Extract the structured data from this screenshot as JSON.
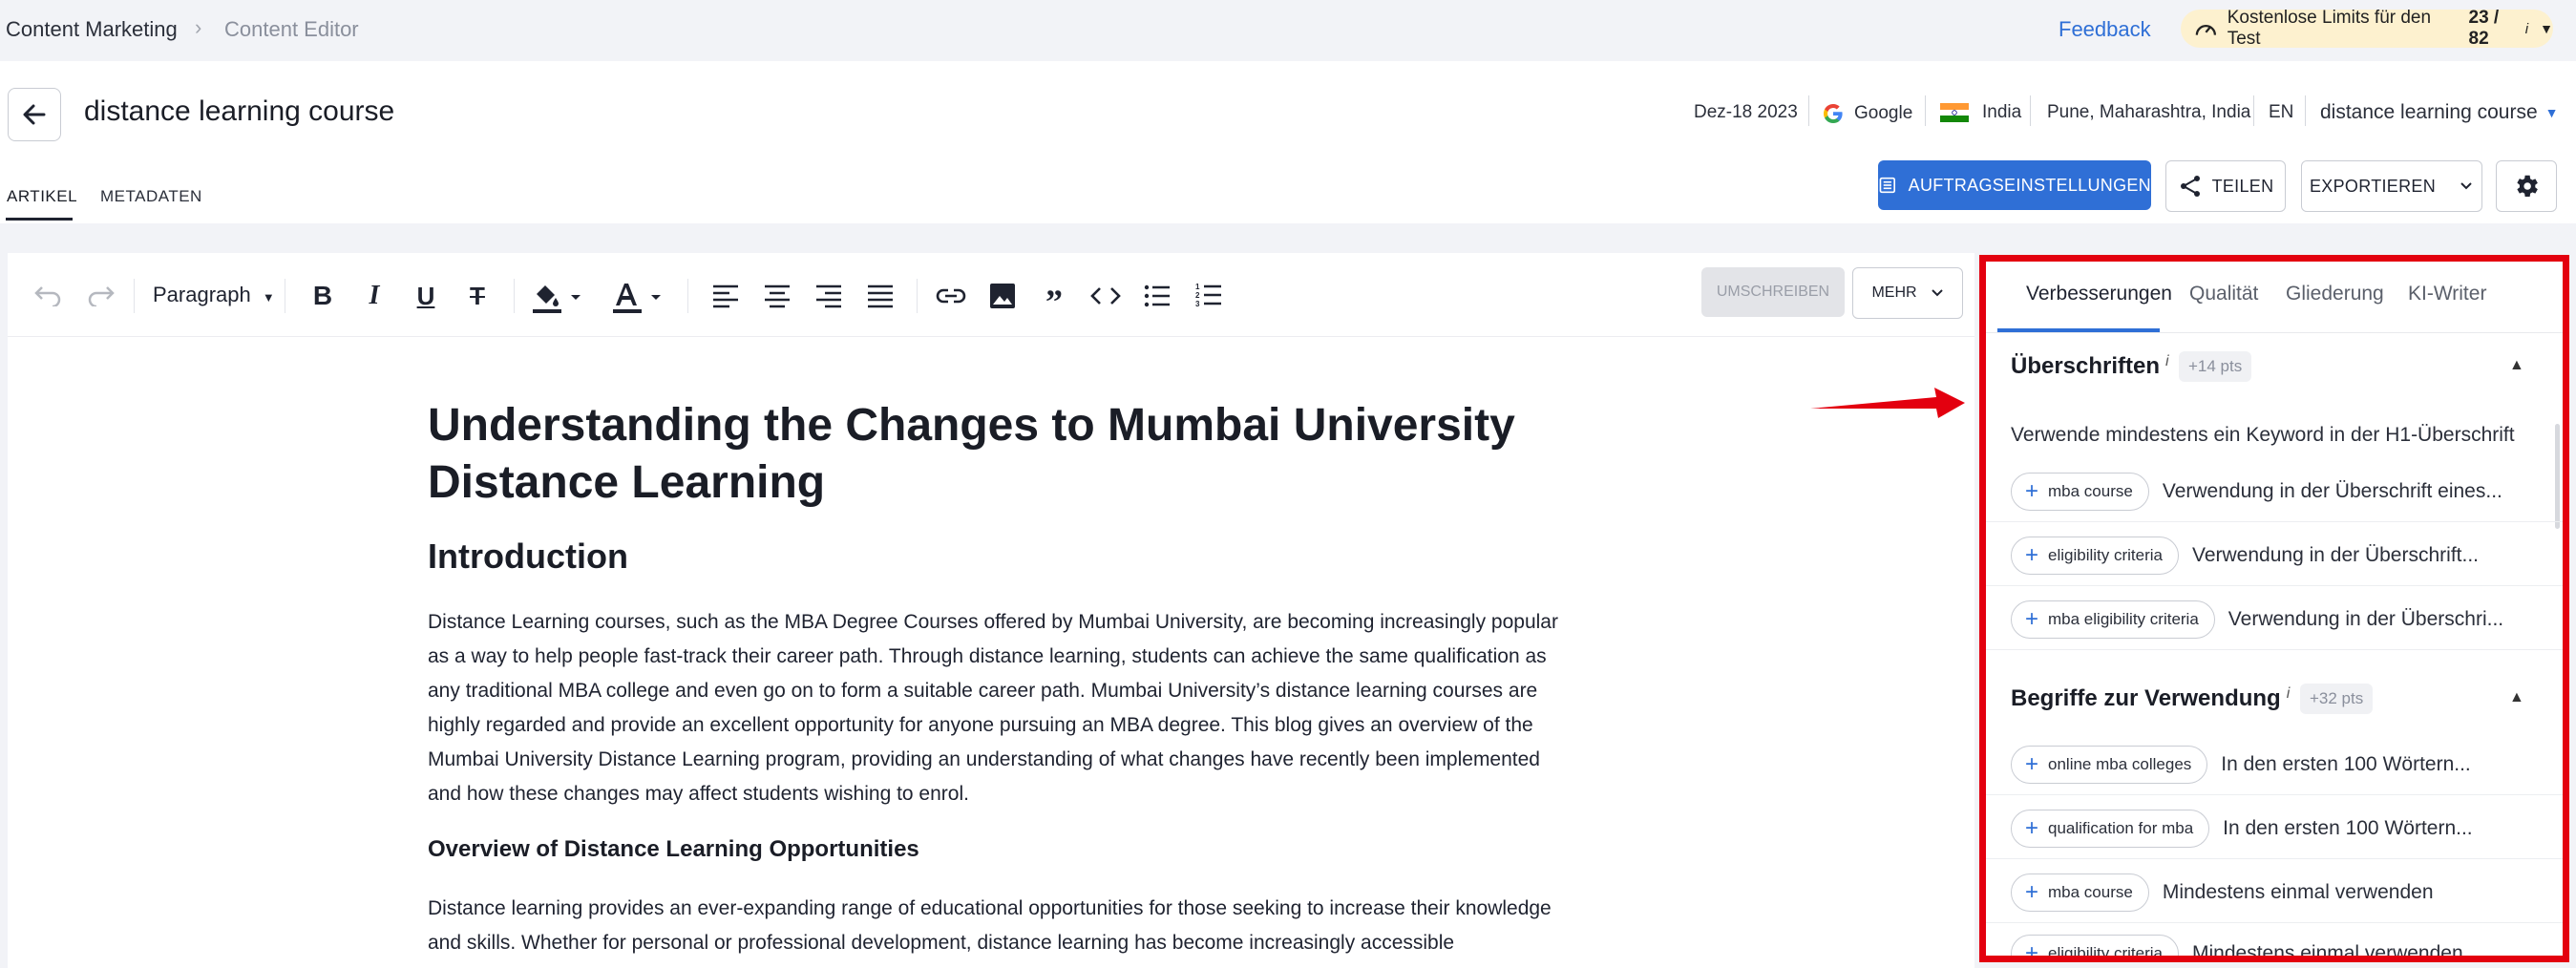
{
  "breadcrumb": {
    "item1": "Content Marketing",
    "sep": "›",
    "item2": "Content Editor"
  },
  "topbar": {
    "feedback": "Feedback",
    "limits_label": "Kostenlose Limits für den Test",
    "limits_value": "23 / 82",
    "limits_info": "i"
  },
  "header": {
    "title": "distance learning course",
    "date": "Dez-18 2023",
    "engine": "Google",
    "country": "India",
    "location": "Pune, Maharashtra, India",
    "language": "EN",
    "keyword": "distance learning course"
  },
  "tabs": {
    "article": "ARTIKEL",
    "metadata": "METADATEN"
  },
  "actions": {
    "settings": "AUFTRAGSEINSTELLUNGEN",
    "share": "TEILEN",
    "export": "EXPORTIEREN"
  },
  "toolbar": {
    "paragraph": "Paragraph",
    "rewrite": "UMSCHREIBEN",
    "more": "MEHR"
  },
  "document": {
    "h1": "Understanding the Changes to Mumbai University Distance Learning",
    "h2": "Introduction",
    "p1": "Distance Learning courses, such as the MBA Degree Courses offered by Mumbai University, are becoming increasingly popular as a way to help people fast-track their career path. Through distance learning, students can achieve the same qualification as any traditional MBA college and even go on to form a suitable career path. Mumbai University’s distance learning courses are highly regarded and provide an excellent opportunity for anyone pursuing an MBA degree. This blog gives an overview of the Mumbai University Distance Learning program, providing an understanding of what changes have recently been implemented and how these changes may affect students wishing to enrol.",
    "h3": "Overview of Distance Learning Opportunities",
    "p2": "Distance learning provides an ever-expanding range of educational opportunities for those seeking to increase their knowledge and skills. Whether for personal or professional development, distance learning has become increasingly accessible"
  },
  "panel": {
    "tabs": [
      "Verbesserungen",
      "Qualität",
      "Gliederung",
      "KI-Writer"
    ],
    "section1": {
      "title": "Überschriften",
      "info": "i",
      "pts": "+14 pts",
      "rule": "Verwende mindestens ein Keyword in der H1-Überschrift"
    },
    "rows1": [
      {
        "chip": "mba course",
        "text": "Verwendung in der Überschrift eines..."
      },
      {
        "chip": "eligibility criteria",
        "text": "Verwendung in der Überschrift..."
      },
      {
        "chip": "mba eligibility criteria",
        "text": "Verwendung in der Überschri..."
      }
    ],
    "section2": {
      "title": "Begriffe zur Verwendung",
      "info": "i",
      "pts": "+32 pts"
    },
    "rows2": [
      {
        "chip": "online mba colleges",
        "text": "In den ersten 100 Wörtern..."
      },
      {
        "chip": "qualification for mba",
        "text": "In den ersten 100 Wörtern..."
      },
      {
        "chip": "mba course",
        "text": "Mindestens einmal verwenden"
      },
      {
        "chip": "eligibility criteria",
        "text": "Mindestens einmal verwenden"
      }
    ]
  },
  "colors": {
    "accent": "#2f6fd6",
    "highlight": "#e3000f",
    "limits_bg": "#fdf1cf"
  }
}
